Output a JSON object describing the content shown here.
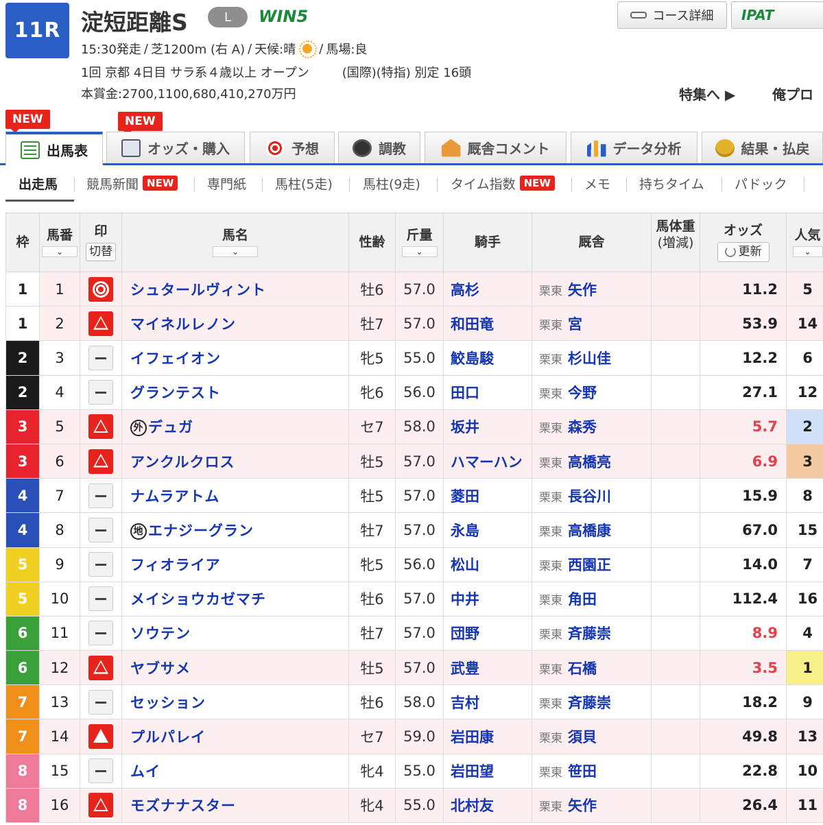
{
  "header": {
    "race_no": "11R",
    "race_name": "淀短距離S",
    "grade": "L",
    "win5": "WIN5",
    "start_time": "15:30発走",
    "course": "芝1200m (右 A)",
    "weather": "天候:晴",
    "track": "馬場:良",
    "meeting": "1回 京都 4日目 サラ系４歳以上 オープン",
    "conditions": "(国際)(特指) 別定 16頭",
    "prize": "本賞金:2700,1100,680,410,270万円",
    "course_button": "コース詳細",
    "ipat_button": "IPAT",
    "special_link": "特集へ ▶",
    "blog_link": "俺プロ"
  },
  "tabs": {
    "new_label": "NEW",
    "main": [
      "出馬表",
      "オッズ・購入",
      "予想",
      "調教",
      "厩舎コメント",
      "データ分析",
      "結果・払戻"
    ],
    "sub": [
      "出走馬",
      "競馬新聞",
      "専門紙",
      "馬柱(5走)",
      "馬柱(9走)",
      "タイム指数",
      "メモ",
      "持ちタイム",
      "パドック"
    ]
  },
  "table": {
    "headers": {
      "waku": "枠",
      "umaban": "馬番",
      "mark": "印",
      "switch": "切替",
      "name": "馬名",
      "sexage": "性齢",
      "weight": "斤量",
      "jockey": "騎手",
      "trainer": "厩舎",
      "body": "馬体重",
      "body_change": "(増減)",
      "odds": "オッズ",
      "update": "更新",
      "popular": "人気"
    },
    "waku_colors": {
      "1": "#ffffff",
      "2": "#1a1a1a",
      "3": "#e8232e",
      "4": "#2850b8",
      "5": "#f0d020",
      "6": "#3aa03a",
      "7": "#f0901a",
      "8": "#ef7a9a"
    },
    "rows": [
      {
        "waku": "1",
        "no": "1",
        "mark": "double-circle",
        "prefix": "",
        "name": "シュタールヴィント",
        "sexage": "牡6",
        "weight": "57.0",
        "jockey": "高杉",
        "area": "栗東",
        "trainer": "矢作",
        "odds": "11.2",
        "popular": "5"
      },
      {
        "waku": "1",
        "no": "2",
        "mark": "triangle",
        "prefix": "",
        "name": "マイネルレノン",
        "sexage": "牡7",
        "weight": "57.0",
        "jockey": "和田竜",
        "area": "栗東",
        "trainer": "宮",
        "odds": "53.9",
        "popular": "14"
      },
      {
        "waku": "2",
        "no": "3",
        "mark": "none",
        "prefix": "",
        "name": "イフェイオン",
        "sexage": "牝5",
        "weight": "55.0",
        "jockey": "鮫島駿",
        "area": "栗東",
        "trainer": "杉山佳",
        "odds": "12.2",
        "popular": "6"
      },
      {
        "waku": "2",
        "no": "4",
        "mark": "none",
        "prefix": "",
        "name": "グランテスト",
        "sexage": "牝6",
        "weight": "56.0",
        "jockey": "田口",
        "area": "栗東",
        "trainer": "今野",
        "odds": "27.1",
        "popular": "12"
      },
      {
        "waku": "3",
        "no": "5",
        "mark": "triangle",
        "prefix": "外",
        "name": "デュガ",
        "sexage": "セ7",
        "weight": "58.0",
        "jockey": "坂井",
        "area": "栗東",
        "trainer": "森秀",
        "odds": "5.7",
        "popular": "2"
      },
      {
        "waku": "3",
        "no": "6",
        "mark": "triangle",
        "prefix": "",
        "name": "アンクルクロス",
        "sexage": "牡5",
        "weight": "57.0",
        "jockey": "ハマーハン",
        "area": "栗東",
        "trainer": "高橋亮",
        "odds": "6.9",
        "popular": "3"
      },
      {
        "waku": "4",
        "no": "7",
        "mark": "none",
        "prefix": "",
        "name": "ナムラアトム",
        "sexage": "牡5",
        "weight": "57.0",
        "jockey": "菱田",
        "area": "栗東",
        "trainer": "長谷川",
        "odds": "15.9",
        "popular": "8"
      },
      {
        "waku": "4",
        "no": "8",
        "mark": "none",
        "prefix": "地",
        "name": "エナジーグラン",
        "sexage": "牡7",
        "weight": "57.0",
        "jockey": "永島",
        "area": "栗東",
        "trainer": "高橋康",
        "odds": "67.0",
        "popular": "15"
      },
      {
        "waku": "5",
        "no": "9",
        "mark": "none",
        "prefix": "",
        "name": "フィオライア",
        "sexage": "牝5",
        "weight": "56.0",
        "jockey": "松山",
        "area": "栗東",
        "trainer": "西園正",
        "odds": "14.0",
        "popular": "7"
      },
      {
        "waku": "5",
        "no": "10",
        "mark": "none",
        "prefix": "",
        "name": "メイショウカゼマチ",
        "sexage": "牡6",
        "weight": "57.0",
        "jockey": "中井",
        "area": "栗東",
        "trainer": "角田",
        "odds": "112.4",
        "popular": "16"
      },
      {
        "waku": "6",
        "no": "11",
        "mark": "none",
        "prefix": "",
        "name": "ソウテン",
        "sexage": "牡7",
        "weight": "57.0",
        "jockey": "団野",
        "area": "栗東",
        "trainer": "斉藤崇",
        "odds": "8.9",
        "popular": "4"
      },
      {
        "waku": "6",
        "no": "12",
        "mark": "triangle",
        "prefix": "",
        "name": "ヤブサメ",
        "sexage": "牡5",
        "weight": "57.0",
        "jockey": "武豊",
        "area": "栗東",
        "trainer": "石橋",
        "odds": "3.5",
        "popular": "1"
      },
      {
        "waku": "7",
        "no": "13",
        "mark": "none",
        "prefix": "",
        "name": "セッション",
        "sexage": "牡6",
        "weight": "58.0",
        "jockey": "吉村",
        "area": "栗東",
        "trainer": "斉藤崇",
        "odds": "18.2",
        "popular": "9"
      },
      {
        "waku": "7",
        "no": "14",
        "mark": "triangle-solid",
        "prefix": "",
        "name": "プルパレイ",
        "sexage": "セ7",
        "weight": "59.0",
        "jockey": "岩田康",
        "area": "栗東",
        "trainer": "須貝",
        "odds": "49.8",
        "popular": "13"
      },
      {
        "waku": "8",
        "no": "15",
        "mark": "none",
        "prefix": "",
        "name": "ムイ",
        "sexage": "牝4",
        "weight": "55.0",
        "jockey": "岩田望",
        "area": "栗東",
        "trainer": "笹田",
        "odds": "22.8",
        "popular": "10"
      },
      {
        "waku": "8",
        "no": "16",
        "mark": "triangle",
        "prefix": "",
        "name": "モズナナスター",
        "sexage": "牝4",
        "weight": "55.0",
        "jockey": "北村友",
        "area": "栗東",
        "trainer": "矢作",
        "odds": "26.4",
        "popular": "11"
      }
    ],
    "popular_colors": {
      "1": "#f8f08a",
      "2": "#cfe0f8",
      "3": "#f4c8a0"
    },
    "odds_highlight_color": "#e8404a"
  }
}
